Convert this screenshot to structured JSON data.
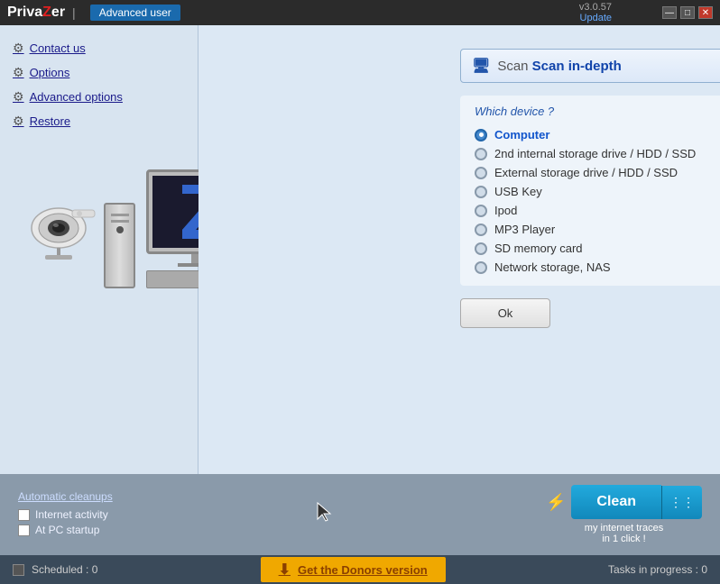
{
  "app": {
    "brand_priv": "Priva",
    "brand_a": "Z",
    "brand_er": "er",
    "user_badge": "Advanced user",
    "version": "v3.0.57",
    "update_label": "Update"
  },
  "window_controls": {
    "minimize": "—",
    "maximize": "□",
    "close": "✕"
  },
  "sidebar": {
    "items": [
      {
        "id": "contact-us",
        "label": "Contact us",
        "icon": "⚙"
      },
      {
        "id": "options",
        "label": "Options",
        "icon": "⚙"
      },
      {
        "id": "advanced-options",
        "label": "Advanced options",
        "icon": "⚙"
      },
      {
        "id": "restore",
        "label": "Restore",
        "icon": "⚙"
      }
    ]
  },
  "scan": {
    "dropdown_label": "Scan in-depth",
    "which_device": "Which device ?",
    "devices": [
      {
        "id": "computer",
        "label": "Computer",
        "selected": true
      },
      {
        "id": "2nd-hdd",
        "label": "2nd internal storage drive / HDD / SSD",
        "selected": false
      },
      {
        "id": "external",
        "label": "External storage drive  / HDD / SSD",
        "selected": false
      },
      {
        "id": "usb",
        "label": "USB Key",
        "selected": false
      },
      {
        "id": "ipod",
        "label": "Ipod",
        "selected": false
      },
      {
        "id": "mp3",
        "label": "MP3 Player",
        "selected": false
      },
      {
        "id": "sd",
        "label": "SD memory card",
        "selected": false
      },
      {
        "id": "nas",
        "label": "Network storage, NAS",
        "selected": false
      }
    ],
    "ok_button": "Ok"
  },
  "bottom": {
    "auto_cleanups_title": "Automatic cleanups",
    "checkboxes": [
      {
        "label": "Internet activity",
        "checked": false
      },
      {
        "label": "At PC startup",
        "checked": false
      }
    ]
  },
  "clean": {
    "button_label": "Clean",
    "subtitle_line1": "my internet traces",
    "subtitle_line2": "in 1 click !"
  },
  "status_bar": {
    "checkbox_label": "",
    "scheduled_label": "Scheduled : 0",
    "donors_icon": "⬇",
    "donors_label": "Get the Donors version",
    "tasks_label": "Tasks in progress : 0"
  }
}
